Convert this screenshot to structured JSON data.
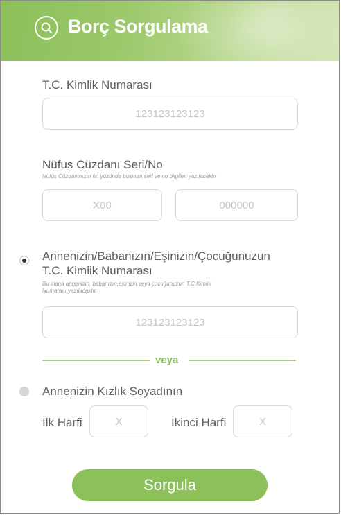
{
  "header": {
    "title": "Borç Sorgulama"
  },
  "tc": {
    "label": "T.C. Kimlik Numarası",
    "placeholder": "123123123123"
  },
  "nufus": {
    "label": "Nüfus Cüzdanı Seri/No",
    "hint": "Nüfus Cüzdanınızın ön yüzünde bulunan seri ve no bilgileri yazılacaktır",
    "seri_placeholder": "X00",
    "no_placeholder": "000000"
  },
  "relative": {
    "label_line1": "Annenizin/Babanızın/Eşinizin/Çocuğunuzun",
    "label_line2": "T.C. Kimlik Numarası",
    "hint_line1": "Bu alana annenizin, babanızın,eşinizin veya çocuğunuzun T.C Kimlik",
    "hint_line2": "Numarası yazılacaktır.",
    "placeholder": "123123123123",
    "selected": true
  },
  "divider": {
    "text": "veya"
  },
  "maiden": {
    "label": "Annenizin Kızlık Soyadının",
    "first_label": "İlk Harfi",
    "first_placeholder": "X",
    "second_label": "İkinci Harfi",
    "second_placeholder": "X",
    "selected": false
  },
  "submit": {
    "label": "Sorgula"
  },
  "colors": {
    "accent": "#8cc15a",
    "label_text": "#5e5e5e"
  }
}
